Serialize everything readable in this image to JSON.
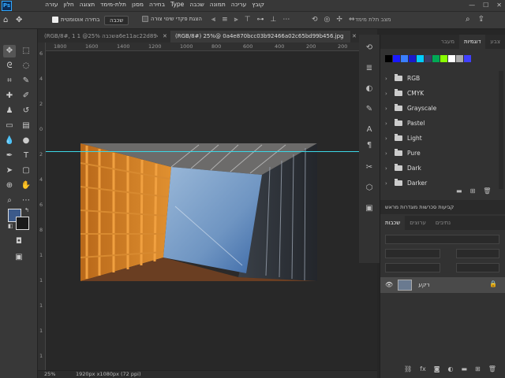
{
  "menu": {
    "logo": "Ps",
    "items": [
      "קובץ",
      "עריכה",
      "תמונה",
      "שכבה",
      "Type",
      "בחירה",
      "מסנן",
      "תלת-מימד",
      "תצוגה",
      "חלון",
      "עזרה"
    ],
    "window_controls": [
      "—",
      "☐",
      "✕"
    ]
  },
  "options": {
    "layer_select": "שכבה",
    "auto_select_label": "בחירה אוטומטית",
    "show_transform_label": "הצגת פקדי שינוי צורה",
    "mode_3d_label": "מצב תלת מימד"
  },
  "tabs": [
    {
      "label": "(RGB/8#) 25%@ 0a4e870bcc03b92466a02c65bd99b456.jpg",
      "active": true
    },
    {
      "label": "(RGB/8#, 1 שכבה 25%@ 1a6e11ac22d894ad341",
      "active": false
    }
  ],
  "rulers": {
    "h_ticks": [
      "1800",
      "1600",
      "1400",
      "1200",
      "1000",
      "800",
      "600",
      "400",
      "200",
      "200"
    ],
    "v_ticks": [
      "6",
      "4",
      "2",
      "0",
      "2",
      "4",
      "6",
      "8",
      "1",
      "1",
      "1",
      "1",
      "1"
    ]
  },
  "status": {
    "zoom": "25%",
    "doc_info": "1920px x1080px (72 ppi)"
  },
  "right_panel": {
    "top_tabs": [
      "צבע",
      "דוגמיות",
      "מעבר"
    ],
    "swatch_colors": [
      "#000000",
      "#1a1aff",
      "#3a7fff",
      "#1a1acc",
      "#00ccff",
      "#3c3c66",
      "#00aa55",
      "#88ff00",
      "#ffffff",
      "#aaaaaa",
      "#4040ff"
    ],
    "folders": [
      "RGB",
      "CMYK",
      "Grayscale",
      "Pastel",
      "Light",
      "Pure",
      "Dark",
      "Darker"
    ],
    "mid_title": "קביעות סכרשות מוגדרות מראש",
    "layer_tabs": [
      "שכבות",
      "ערוצים",
      "נתיבים"
    ],
    "layer_name": "רקע"
  },
  "colors": {
    "fg": "#3c5a8a",
    "bg": "#1a1a1a",
    "guide": "#3bd7e6"
  }
}
